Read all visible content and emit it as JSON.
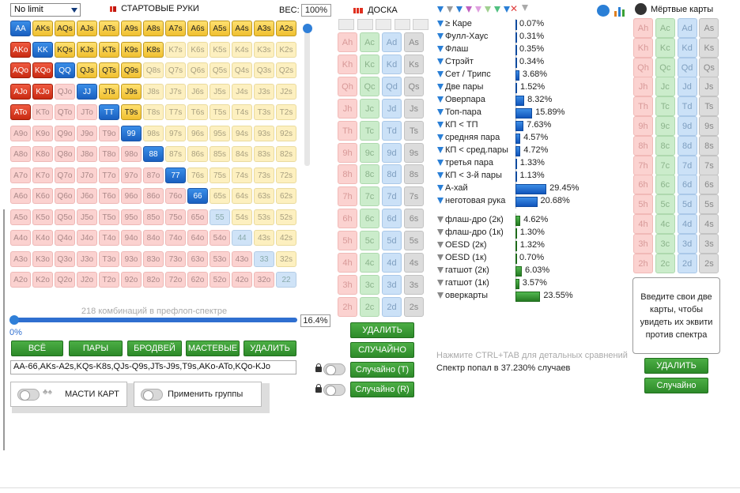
{
  "top": {
    "game_select": "No limit",
    "start_hands_title": "СТАРТОВЫЕ РУКИ",
    "weight_label": "ВЕС:",
    "weight_value": "100%"
  },
  "ranks": [
    "A",
    "K",
    "Q",
    "J",
    "T",
    "9",
    "8",
    "7",
    "6",
    "5",
    "4",
    "3",
    "2"
  ],
  "selected_range_text": "AA-66,AKs-A2s,KQs-K8s,QJs-Q9s,JTs-J9s,T9s,AKo-ATo,KQo-KJo",
  "range_info": {
    "combos_text": "218 комбинаций в префлоп-спектре",
    "percent": "16.4%",
    "slider_min": "0%"
  },
  "range_buttons": {
    "all": "ВСЁ",
    "pairs": "ПАРЫ",
    "broadway": "БРОДВЕЙ",
    "suited": "МАСТЕВЫЕ",
    "delete": "УДАЛИТЬ"
  },
  "options": {
    "suits": "МАСТИ КАРТ",
    "groups": "Применить группы"
  },
  "board": {
    "title": "ДОСКА",
    "delete": "УДАЛИТЬ",
    "random": "СЛУЧАЙНО",
    "random_t": "Случайно (T)",
    "random_r": "Случайно (R)"
  },
  "deck_ranks": [
    "A",
    "K",
    "Q",
    "J",
    "T",
    "9",
    "8",
    "7",
    "6",
    "5",
    "4",
    "3",
    "2"
  ],
  "deck_suits": [
    "h",
    "c",
    "d",
    "s"
  ],
  "stats": [
    {
      "label": "≥ Каре",
      "value": "0.07%",
      "pct": 0.07,
      "color": "blue"
    },
    {
      "label": "Фулл-Хаус",
      "value": "0.31%",
      "pct": 0.31,
      "color": "blue"
    },
    {
      "label": "Флаш",
      "value": "0.35%",
      "pct": 0.35,
      "color": "blue"
    },
    {
      "label": "Стрэйт",
      "value": "0.34%",
      "pct": 0.34,
      "color": "blue"
    },
    {
      "label": "Сет / Трипс",
      "value": "3.68%",
      "pct": 3.68,
      "color": "blue"
    },
    {
      "label": "Две пары",
      "value": "1.52%",
      "pct": 1.52,
      "color": "blue"
    },
    {
      "label": "Оверпара",
      "value": "8.32%",
      "pct": 8.32,
      "color": "blue"
    },
    {
      "label": "Топ-пара",
      "value": "15.89%",
      "pct": 15.89,
      "color": "blue"
    },
    {
      "label": "КП < ТП",
      "value": "7.63%",
      "pct": 7.63,
      "color": "blue"
    },
    {
      "label": "средняя пара",
      "value": "4.57%",
      "pct": 4.57,
      "color": "blue"
    },
    {
      "label": "КП < сред.пары",
      "value": "4.72%",
      "pct": 4.72,
      "color": "blue"
    },
    {
      "label": "третья пара",
      "value": "1.33%",
      "pct": 1.33,
      "color": "blue"
    },
    {
      "label": "КП < 3-й пары",
      "value": "1.13%",
      "pct": 1.13,
      "color": "blue"
    },
    {
      "label": "А-хай",
      "value": "29.45%",
      "pct": 29.45,
      "color": "blue"
    },
    {
      "label": "неготовая рука",
      "value": "20.68%",
      "pct": 20.68,
      "color": "blue"
    }
  ],
  "draws": [
    {
      "label": "флаш-дро (2к)",
      "value": "4.62%",
      "pct": 4.62,
      "color": "green"
    },
    {
      "label": "флаш-дро (1к)",
      "value": "1.30%",
      "pct": 1.3,
      "color": "green"
    },
    {
      "label": "OESD (2к)",
      "value": "1.32%",
      "pct": 1.32,
      "color": "green"
    },
    {
      "label": "OESD (1к)",
      "value": "0.70%",
      "pct": 0.7,
      "color": "green"
    },
    {
      "label": "гатшот (2к)",
      "value": "6.03%",
      "pct": 6.03,
      "color": "green"
    },
    {
      "label": "гатшот (1к)",
      "value": "3.57%",
      "pct": 3.57,
      "color": "green"
    },
    {
      "label": "оверкарты",
      "value": "23.55%",
      "pct": 23.55,
      "color": "green"
    }
  ],
  "hints": {
    "ctrl_tab": "Нажмите CTRL+TAB для детальных сравнений",
    "hit_rate": "Спектр попал в 37.230% случаев"
  },
  "dead": {
    "title": "Мёртвые карты",
    "tip": "Введите свои две карты, чтобы увидеть их эквити против спектра",
    "delete": "УДАЛИТЬ",
    "random": "Случайно"
  },
  "colors": {
    "green_button": "#3a9c35",
    "selected_pair": "#1a60c0",
    "selected_suited": "#f0c030",
    "selected_offsuit": "#c82a12"
  }
}
